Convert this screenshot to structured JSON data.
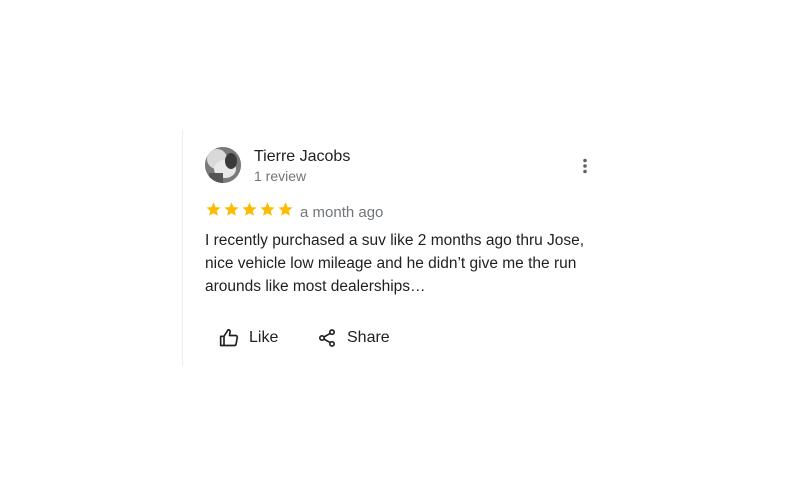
{
  "review": {
    "author_name": "Tierre Jacobs",
    "author_review_count": "1 review",
    "rating": 5,
    "rating_max": 5,
    "date": "a month ago",
    "text": "I recently purchased a suv like 2 months ago thru Jose, nice vehicle low mileage and he didn’t give me the run arounds like most dealerships…",
    "star_color": "#fbbc04"
  },
  "actions": {
    "like_label": "Like",
    "like_icon": "thumbs-up-icon",
    "share_label": "Share",
    "share_icon": "share-icon",
    "more_icon": "more-vert-icon"
  }
}
